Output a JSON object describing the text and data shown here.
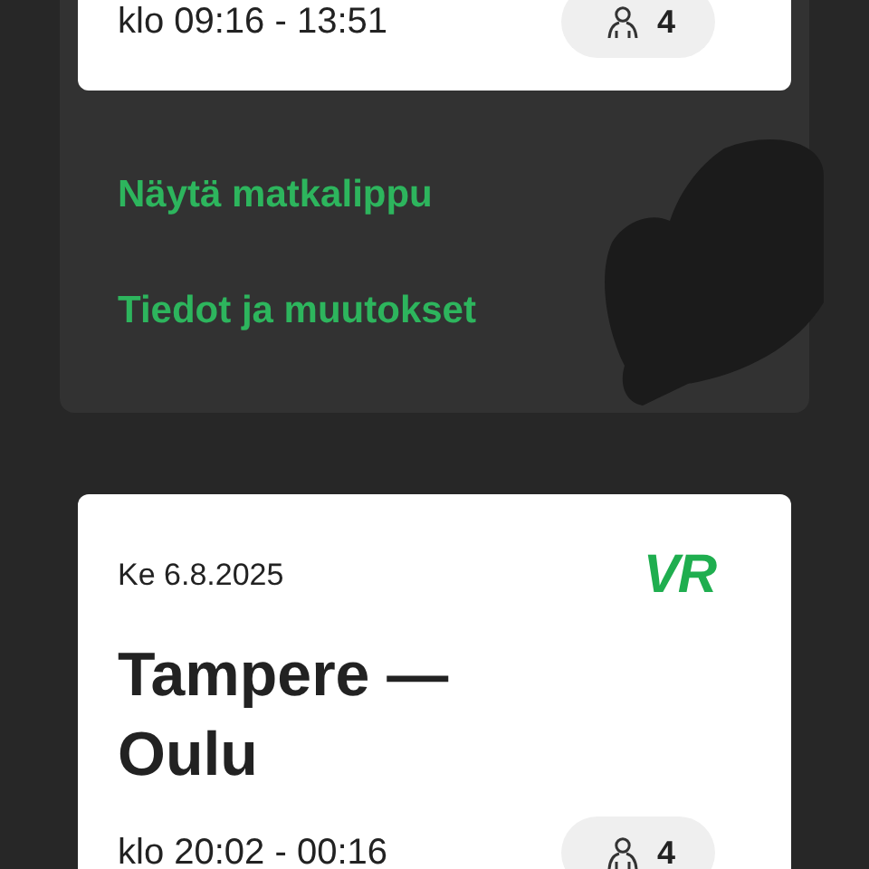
{
  "trips": [
    {
      "time": "klo 09:16 - 13:51",
      "passengers": "4",
      "actions": [
        "Näytä matkalippu",
        "Tiedot ja muutokset"
      ]
    },
    {
      "date": "Ke 6.8.2025",
      "logo": "VR",
      "route": "Tampere — Oulu",
      "time": "klo 20:02 - 00:16",
      "passengers": "4"
    }
  ]
}
